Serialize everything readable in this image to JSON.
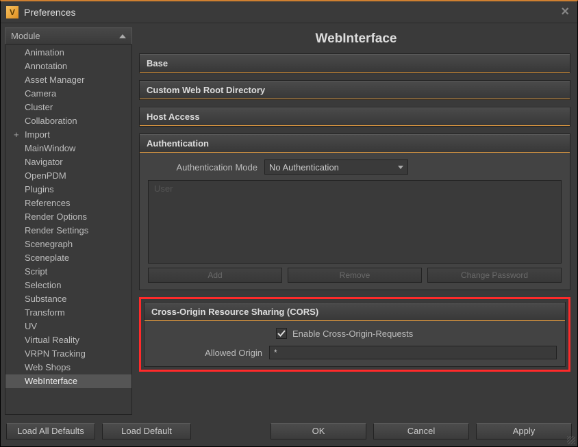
{
  "window": {
    "title": "Preferences",
    "app_icon_letter": "V"
  },
  "sidebar": {
    "header": "Module",
    "items": [
      {
        "label": "Animation",
        "children": false,
        "selected": false
      },
      {
        "label": "Annotation",
        "children": false,
        "selected": false
      },
      {
        "label": "Asset Manager",
        "children": false,
        "selected": false
      },
      {
        "label": "Camera",
        "children": false,
        "selected": false
      },
      {
        "label": "Cluster",
        "children": false,
        "selected": false
      },
      {
        "label": "Collaboration",
        "children": false,
        "selected": false
      },
      {
        "label": "Import",
        "children": true,
        "selected": false
      },
      {
        "label": "MainWindow",
        "children": false,
        "selected": false
      },
      {
        "label": "Navigator",
        "children": false,
        "selected": false
      },
      {
        "label": "OpenPDM",
        "children": false,
        "selected": false
      },
      {
        "label": "Plugins",
        "children": false,
        "selected": false
      },
      {
        "label": "References",
        "children": false,
        "selected": false
      },
      {
        "label": "Render Options",
        "children": false,
        "selected": false
      },
      {
        "label": "Render Settings",
        "children": false,
        "selected": false
      },
      {
        "label": "Scenegraph",
        "children": false,
        "selected": false
      },
      {
        "label": "Sceneplate",
        "children": false,
        "selected": false
      },
      {
        "label": "Script",
        "children": false,
        "selected": false
      },
      {
        "label": "Selection",
        "children": false,
        "selected": false
      },
      {
        "label": "Substance",
        "children": false,
        "selected": false
      },
      {
        "label": "Transform",
        "children": false,
        "selected": false
      },
      {
        "label": "UV",
        "children": false,
        "selected": false
      },
      {
        "label": "Virtual Reality",
        "children": false,
        "selected": false
      },
      {
        "label": "VRPN Tracking",
        "children": false,
        "selected": false
      },
      {
        "label": "Web Shops",
        "children": false,
        "selected": false
      },
      {
        "label": "WebInterface",
        "children": false,
        "selected": true
      }
    ]
  },
  "page": {
    "title": "WebInterface",
    "base": {
      "header": "Base"
    },
    "webroot": {
      "header": "Custom Web Root Directory"
    },
    "hostaccess": {
      "header": "Host Access"
    },
    "auth": {
      "header": "Authentication",
      "mode_label": "Authentication Mode",
      "mode_value": "No Authentication",
      "userlist_header": "User",
      "add": "Add",
      "remove": "Remove",
      "changepw": "Change Password"
    },
    "cors": {
      "header": "Cross-Origin Resource Sharing (CORS)",
      "enable_label": "Enable Cross-Origin-Requests",
      "enabled": true,
      "origin_label": "Allowed Origin",
      "origin_value": "*"
    }
  },
  "footer": {
    "load_all": "Load All Defaults",
    "load": "Load Default",
    "ok": "OK",
    "cancel": "Cancel",
    "apply": "Apply"
  }
}
